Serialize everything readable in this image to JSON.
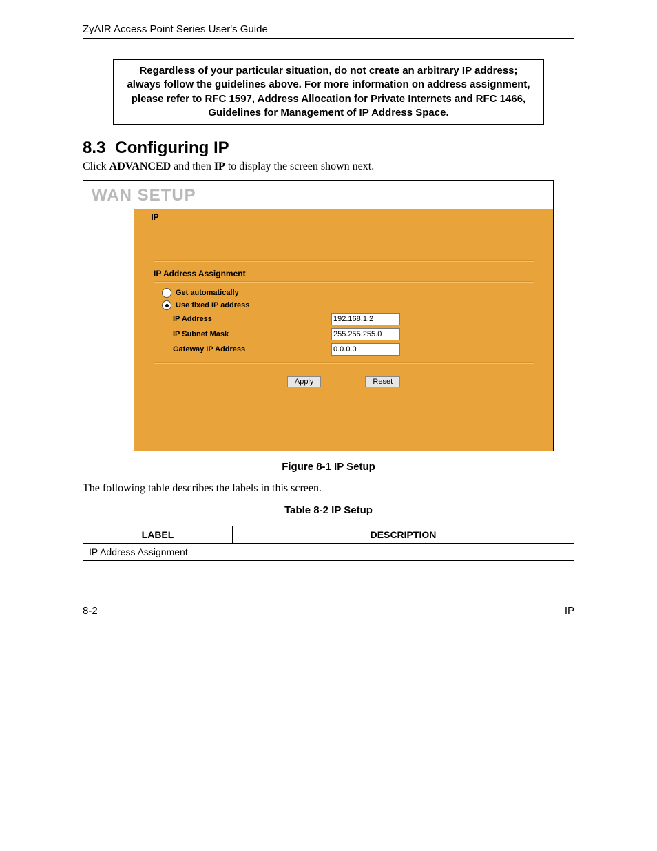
{
  "header": {
    "title": "ZyAIR Access Point Series User's Guide"
  },
  "note": "Regardless of your particular situation, do not create an arbitrary IP address; always follow the guidelines above. For more information on address assignment, please refer to RFC 1597, Address Allocation for Private Internets and RFC 1466, Guidelines for Management of IP Address Space.",
  "section": {
    "number": "8.3",
    "title": "Configuring IP",
    "intro_prefix": "Click ",
    "intro_bold1": "ADVANCED",
    "intro_mid": " and then ",
    "intro_bold2": "IP",
    "intro_suffix": " to display the screen shown next."
  },
  "screenshot": {
    "title": "WAN SETUP",
    "tab": "IP",
    "group_label": "IP Address Assignment",
    "radio": {
      "auto": "Get automatically",
      "fixed": "Use fixed IP address",
      "selected": "fixed"
    },
    "fields": {
      "ip_label": "IP Address",
      "ip_value": "192.168.1.2",
      "mask_label": "IP Subnet Mask",
      "mask_value": "255.255.255.0",
      "gw_label": "Gateway IP Address",
      "gw_value": "0.0.0.0"
    },
    "buttons": {
      "apply": "Apply",
      "reset": "Reset"
    }
  },
  "figure_caption": "Figure 8-1 IP Setup",
  "table_intro": "The following table describes the labels in this screen.",
  "table_caption": "Table 8-2 IP Setup",
  "table": {
    "head_label": "LABEL",
    "head_desc": "DESCRIPTION",
    "rows": [
      {
        "label": "IP Address Assignment",
        "desc": ""
      }
    ]
  },
  "footer": {
    "left": "8-2",
    "right": "IP"
  }
}
